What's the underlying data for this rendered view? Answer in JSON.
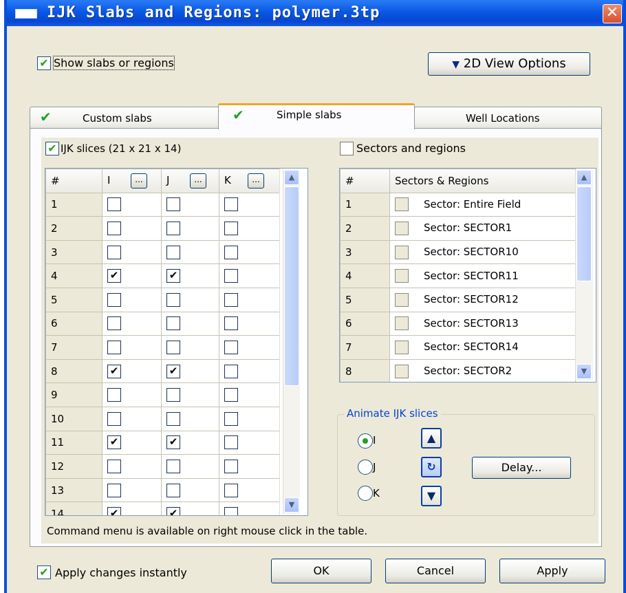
{
  "window": {
    "title": "IJK Slabs and Regions: polymer.3tp",
    "close_symbol": "✕"
  },
  "top": {
    "show_label": "Show slabs or regions",
    "show_checked": true,
    "view_options_label": "2D View Options"
  },
  "tabs": [
    {
      "label": "Custom slabs",
      "checked": true,
      "active": false
    },
    {
      "label": "Simple slabs",
      "checked": true,
      "active": true
    },
    {
      "label": "Well Locations",
      "checked": false,
      "active": false
    }
  ],
  "ijk": {
    "label": "IJK slices (21 x 21 x 14)",
    "checked": true,
    "headers": [
      "#",
      "I",
      "J",
      "K"
    ],
    "ellipsis": "...",
    "rows": [
      {
        "n": "1",
        "i": false,
        "j": false,
        "k": false
      },
      {
        "n": "2",
        "i": false,
        "j": false,
        "k": false
      },
      {
        "n": "3",
        "i": false,
        "j": false,
        "k": false
      },
      {
        "n": "4",
        "i": true,
        "j": true,
        "k": false
      },
      {
        "n": "5",
        "i": false,
        "j": false,
        "k": false
      },
      {
        "n": "6",
        "i": false,
        "j": false,
        "k": false
      },
      {
        "n": "7",
        "i": false,
        "j": false,
        "k": false
      },
      {
        "n": "8",
        "i": true,
        "j": true,
        "k": false
      },
      {
        "n": "9",
        "i": false,
        "j": false,
        "k": false
      },
      {
        "n": "10",
        "i": false,
        "j": false,
        "k": false
      },
      {
        "n": "11",
        "i": true,
        "j": true,
        "k": false
      },
      {
        "n": "12",
        "i": false,
        "j": false,
        "k": false
      },
      {
        "n": "13",
        "i": false,
        "j": false,
        "k": false
      },
      {
        "n": "14",
        "i": true,
        "j": true,
        "k": false
      }
    ]
  },
  "sectors": {
    "label": "Sectors and regions",
    "checked": false,
    "headers": [
      "#",
      "Sectors & Regions"
    ],
    "rows": [
      {
        "n": "1",
        "name": "Sector: Entire  Field"
      },
      {
        "n": "2",
        "name": "Sector: SECTOR1"
      },
      {
        "n": "3",
        "name": "Sector: SECTOR10"
      },
      {
        "n": "4",
        "name": "Sector: SECTOR11"
      },
      {
        "n": "5",
        "name": "Sector: SECTOR12"
      },
      {
        "n": "6",
        "name": "Sector: SECTOR13"
      },
      {
        "n": "7",
        "name": "Sector: SECTOR14"
      },
      {
        "n": "8",
        "name": "Sector: SECTOR2"
      }
    ]
  },
  "animate": {
    "title": "Animate IJK slices",
    "options": [
      {
        "label": "I",
        "selected": true
      },
      {
        "label": "J",
        "selected": false
      },
      {
        "label": "K",
        "selected": false
      }
    ],
    "delay_label": "Delay..."
  },
  "status": "Command menu is available on right mouse click in the table.",
  "bottom": {
    "apply_instantly_label": "Apply changes instantly",
    "apply_instantly_checked": true,
    "ok_label": "OK",
    "cancel_label": "Cancel",
    "apply_label": "Apply"
  },
  "colors": {
    "title_bar": "#0a58e4",
    "window_bg": "#ece9d8",
    "check_green": "#21a121",
    "legend_blue": "#0046d5",
    "tab_accent": "#f0a428"
  }
}
